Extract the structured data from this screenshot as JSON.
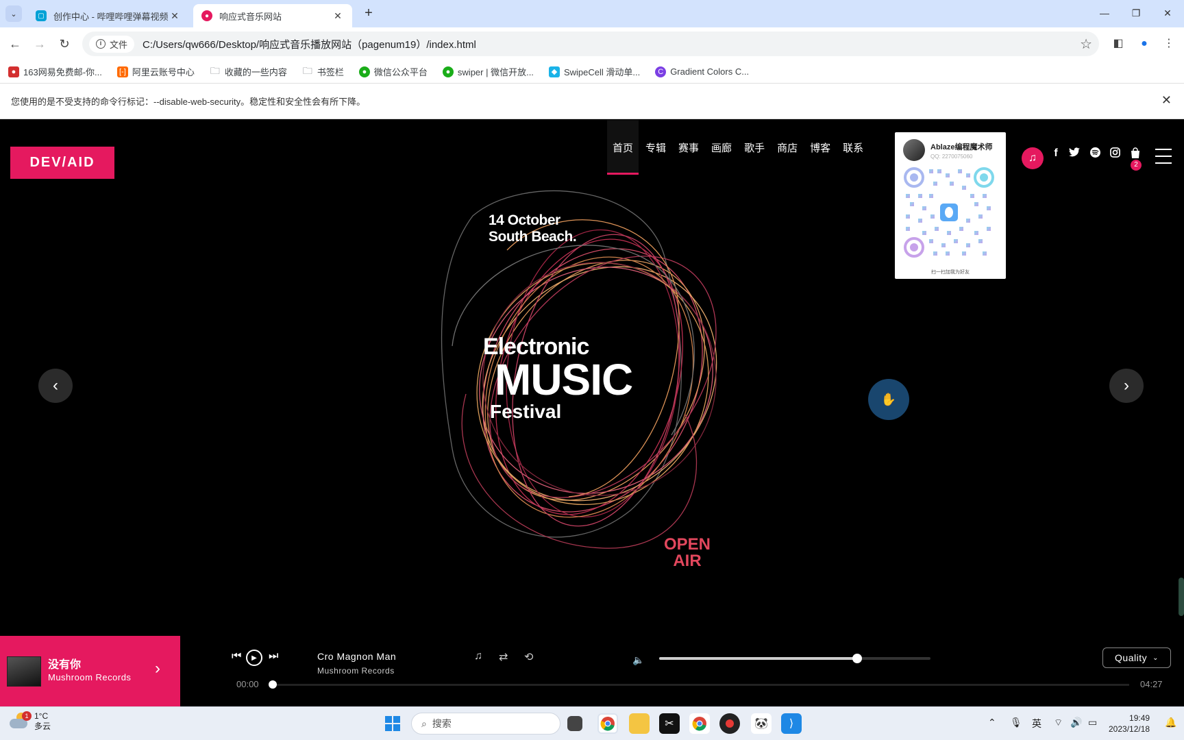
{
  "browser": {
    "tabs": [
      {
        "label": "创作中心 - 哔哩哔哩弹幕视频网",
        "favicon": "bilibili-icon"
      },
      {
        "label": "响应式音乐网站",
        "favicon": "site-icon"
      }
    ],
    "address": {
      "chip": "文件",
      "url": "C:/Users/qw666/Desktop/响应式音乐播放网站（pagenum19）/index.html"
    },
    "bookmarks": [
      {
        "label": "163网易免费邮-你...",
        "icon": "netease-icon",
        "color": "#d32f2f"
      },
      {
        "label": "阿里云账号中心",
        "icon": "aliyun-icon",
        "color": "#ff6a00"
      },
      {
        "label": "收藏的一些内容",
        "icon": "folder-icon",
        "color": "#5f6368"
      },
      {
        "label": "书签栏",
        "icon": "folder-icon",
        "color": "#5f6368"
      },
      {
        "label": "微信公众平台",
        "icon": "wechat-icon",
        "color": "#1aad19"
      },
      {
        "label": "swiper | 微信开放...",
        "icon": "wechat-icon",
        "color": "#1aad19"
      },
      {
        "label": "SwipeCell 滑动单...",
        "icon": "vant-icon",
        "color": "#1ab3e8"
      },
      {
        "label": "Gradient Colors C...",
        "icon": "gradient-icon",
        "color": "#7b3fe4"
      }
    ],
    "infobar": "您使用的是不受支持的命令行标记：--disable-web-security。稳定性和安全性会有所下降。"
  },
  "site": {
    "logo": "DEV/AID",
    "nav": [
      "首页",
      "专辑",
      "赛事",
      "画廊",
      "歌手",
      "商店",
      "博客",
      "联系"
    ],
    "nav_active": 0,
    "cart_count": "2",
    "accent": "#e5195f",
    "qr_card": {
      "name": "Ablaze编程魔术师",
      "qq": "QQ: 2270075060",
      "caption": "扫一扫加我为好友"
    },
    "poster": {
      "date_line1": "14 October",
      "date_line2": "South Beach.",
      "title1": "Electronic",
      "title2": "MUSIC",
      "title3": "Festival",
      "tag1": "OPEN",
      "tag2": "AIR"
    }
  },
  "player": {
    "now_title": "没有你",
    "now_label": "Mushroom Records",
    "track_title": "Cro Magnon Man",
    "track_label": "Mushroom Records",
    "current_time": "00:00",
    "duration": "04:27",
    "progress_fraction": 0.0,
    "volume_fraction": 0.73,
    "quality": "Quality"
  },
  "taskbar": {
    "weather_temp": "1°C",
    "weather_desc": "多云",
    "weather_badge": "1",
    "search_placeholder": "搜索",
    "ime": "英",
    "time": "19:49",
    "date": "2023/12/18"
  }
}
